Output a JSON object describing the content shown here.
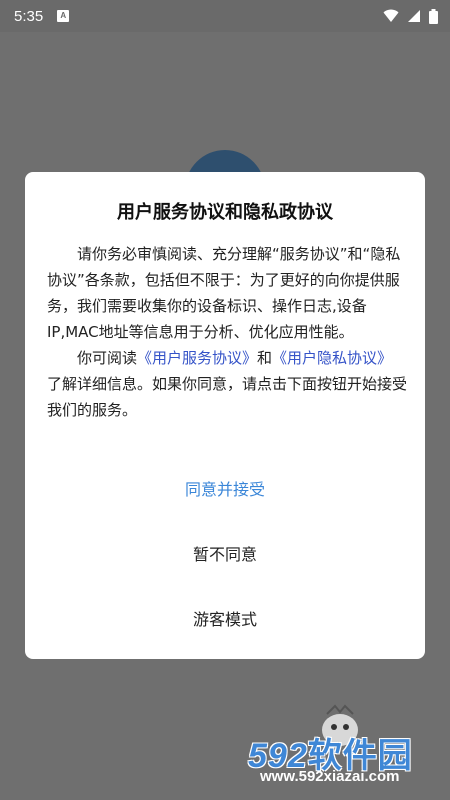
{
  "status_bar": {
    "time": "5:35",
    "notif_glyph": "A"
  },
  "dialog": {
    "title": "用户服务协议和隐私政协议",
    "para1": "请你务必审慎阅读、充分理解“服务协议”和“隐私协议”各条款，包括但不限于：为了更好的向你提供服务，我们需要收集你的设备标识、操作日志,设备IP,MAC地址等信息用于分析、优化应用性能。",
    "para2_prefix": "你可阅读",
    "link_service": "《用户服务协议》",
    "para2_and": "和",
    "link_privacy": "《用户隐私协议》",
    "para2_suffix": "了解详细信息。如果你同意，请点击下面按钮开始接受我们的服务。",
    "agree_label": "同意并接受",
    "decline_label": "暂不同意",
    "guest_label": "游客模式"
  },
  "watermark": {
    "brand": "592",
    "brand_cn": "软件园",
    "url": "www.592xiazai.com"
  },
  "colors": {
    "link": "#3553c8",
    "primary_action": "#3a86d8",
    "overlay": "#6f6f6f"
  }
}
